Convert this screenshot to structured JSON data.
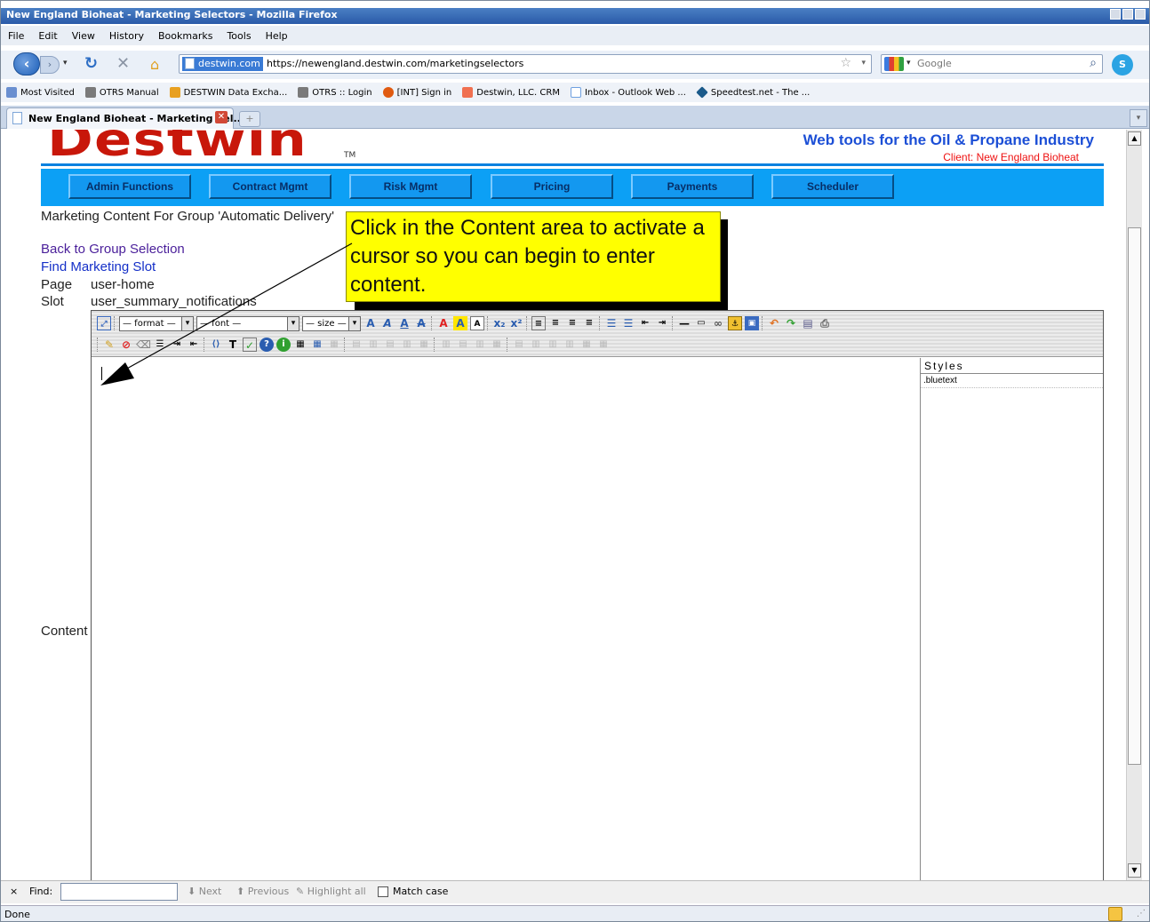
{
  "window": {
    "title": "New England Bioheat - Marketing Selectors - Mozilla Firefox"
  },
  "menu": [
    "File",
    "Edit",
    "View",
    "History",
    "Bookmarks",
    "Tools",
    "Help"
  ],
  "address": {
    "site_badge": "destwin.com",
    "url": "https://newengland.destwin.com/marketingselectors",
    "search_placeholder": "Google"
  },
  "bookmarks": [
    {
      "label": "Most Visited",
      "color": "#6a8fd0"
    },
    {
      "label": "OTRS Manual",
      "color": "#7a7a7a"
    },
    {
      "label": "DESTWIN Data Excha...",
      "color": "#e8a020"
    },
    {
      "label": "OTRS :: Login",
      "color": "#7a7a7a"
    },
    {
      "label": "[INT] Sign in",
      "color": "#e05a10"
    },
    {
      "label": "Destwin, LLC. CRM",
      "color": "#f07050"
    },
    {
      "label": "Inbox - Outlook Web ...",
      "color": "#6ea0e0"
    },
    {
      "label": "Speedtest.net - The ...",
      "color": "#1a5a8a"
    }
  ],
  "tab": {
    "label": "New England Bioheat - Marketing Sel...",
    "new_tab": "+"
  },
  "page": {
    "logo": "Destwin",
    "logo_tm": "TM",
    "tagline": "Web tools for the Oil & Propane Industry",
    "client": "Client: New England Bioheat",
    "nav": [
      "Admin Functions",
      "Contract Mgmt",
      "Risk Mgmt",
      "Pricing",
      "Payments",
      "Scheduler"
    ],
    "heading": "Marketing Content For Group 'Automatic Delivery'",
    "back_link": "Back to Group Selection",
    "find_link": "Find Marketing Slot",
    "page_label": "Page",
    "page_value": "user-home",
    "slot_label": "Slot",
    "slot_value": "user_summary_notifications",
    "content_label": "Content"
  },
  "callout": {
    "text": "Click in the Content area to activate a cursor so you can begin to enter content."
  },
  "editor": {
    "format_select": "— format —",
    "font_select": "— font —",
    "size_select": "— size —",
    "styles_header": "Styles",
    "styles": [
      ".bluetext"
    ]
  },
  "findbar": {
    "close": "×",
    "label": "Find:",
    "next": "Next",
    "previous": "Previous",
    "highlight": "Highlight all",
    "match_case": "Match case"
  },
  "status": {
    "text": "Done"
  }
}
